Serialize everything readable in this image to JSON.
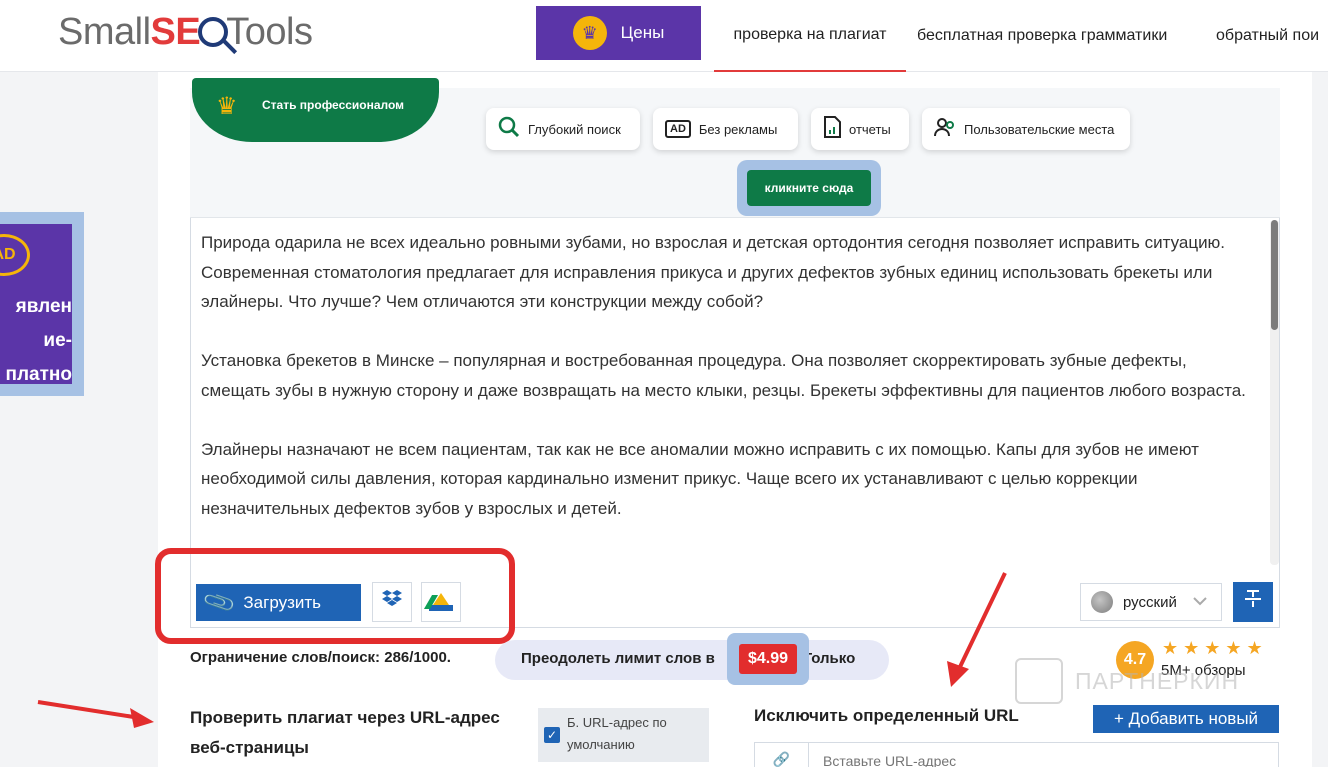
{
  "header": {
    "logo_prefix": "Small",
    "logo_seo": "SE",
    "logo_suffix": "Tools",
    "prices_label": "Цены",
    "nav": [
      "проверка на плагиат",
      "бесплатная проверка грамматики",
      "обратный пои"
    ]
  },
  "left_ad": {
    "icon_label": "AD",
    "text": [
      "явлен",
      "ие-",
      "платно"
    ]
  },
  "pro": {
    "ribbon_label": "Стать профессионалом",
    "features": [
      {
        "icon": "search-icon",
        "label": "Глубокий поиск"
      },
      {
        "icon": "ad-icon",
        "icon_text": "AD",
        "label": "Без рекламы"
      },
      {
        "icon": "report-icon",
        "label": "отчеты"
      },
      {
        "icon": "users-icon",
        "label": "Пользовательские места"
      }
    ],
    "click_label": "кликните сюда"
  },
  "editor": {
    "paragraphs": [
      "Природа одарила не всех идеально ровными зубами, но взрослая и детская ортодонтия сегодня позволяет исправить ситуацию. Современная стоматология предлагает для исправления прикуса и других дефектов зубных единиц использовать брекеты или элайнеры. Что лучше? Чем отличаются эти конструкции между собой?",
      "Установка брекетов в Минске – популярная и востребованная процедура. Она позволяет скорректировать зубные дефекты, смещать зубы в нужную сторону и даже возвращать на место клыки, резцы. Брекеты эффективны для пациентов любого возраста.",
      "Элайнеры назначают не всем пациентам, так как не все аномалии можно исправить с их помощью. Капы для зубов не имеют необходимой силы давления, которая кардинально изменит прикус. Чаще всего их устанавливают с целью коррекции незначительных дефектов зубов у взрослых и детей."
    ],
    "upload_label": "Загрузить",
    "language": "русский"
  },
  "limits": {
    "word_limit": "Ограничение слов/поиск: 286/1000.",
    "overcome_prefix": "Преодолеть лимит слов в",
    "price": "$4.99",
    "overcome_suffix": "Только"
  },
  "rating": {
    "score": "4.7",
    "stars": "★★★★★",
    "reviews": "5M+ обзоры"
  },
  "watermark": "ПАРТНЕРКИН",
  "url_check": {
    "title": "Проверить плагиат через URL-адрес веб-страницы",
    "default_url_label": "Б. URL-адрес по умолчанию",
    "exclude_title": "Исключить определенный URL",
    "add_new_label": "+ Добавить новый",
    "url_placeholder": "Вставьте URL-адрес"
  },
  "colors": {
    "purple": "#5b35a8",
    "green": "#0e7a47",
    "blue": "#1f64b5",
    "red": "#e22d2d",
    "gold": "#f5a623"
  }
}
